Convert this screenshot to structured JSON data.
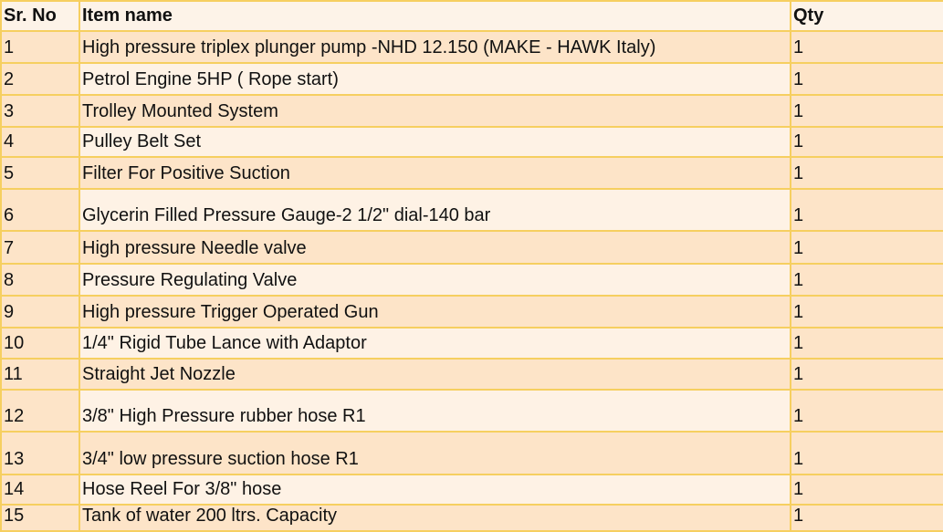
{
  "table": {
    "headers": {
      "sr": "Sr. No",
      "item": "Item name",
      "qty": "Qty"
    },
    "rows": [
      {
        "sr": "1",
        "item": "High pressure triplex plunger pump -NHD 12.150 (MAKE - HAWK Italy)",
        "qty": "1"
      },
      {
        "sr": "2",
        "item": "Petrol Engine 5HP ( Rope start)",
        "qty": "1"
      },
      {
        "sr": "3",
        "item": "Trolley Mounted System",
        "qty": "1"
      },
      {
        "sr": "4",
        "item": "Pulley Belt Set",
        "qty": "1"
      },
      {
        "sr": "5",
        "item": "Filter For Positive Suction",
        "qty": "1"
      },
      {
        "sr": "6",
        "item": "Glycerin Filled Pressure Gauge-2 1/2\" dial-140 bar",
        "qty": "1"
      },
      {
        "sr": "7",
        "item": "High pressure Needle valve",
        "qty": "1"
      },
      {
        "sr": "8",
        "item": "Pressure Regulating Valve",
        "qty": "1"
      },
      {
        "sr": "9",
        "item": "High pressure Trigger Operated Gun",
        "qty": "1"
      },
      {
        "sr": "10",
        "item": "1/4\" Rigid Tube Lance with Adaptor",
        "qty": "1"
      },
      {
        "sr": "11",
        "item": "Straight Jet Nozzle",
        "qty": "1"
      },
      {
        "sr": "12",
        "item": "3/8\" High Pressure rubber hose R1",
        "qty": "1"
      },
      {
        "sr": "13",
        "item": "3/4\" low pressure suction hose R1",
        "qty": "1"
      },
      {
        "sr": "14",
        "item": "Hose Reel For 3/8\" hose",
        "qty": "1"
      },
      {
        "sr": "15",
        "item": "Tank of water 200 ltrs. Capacity",
        "qty": "1"
      }
    ]
  }
}
